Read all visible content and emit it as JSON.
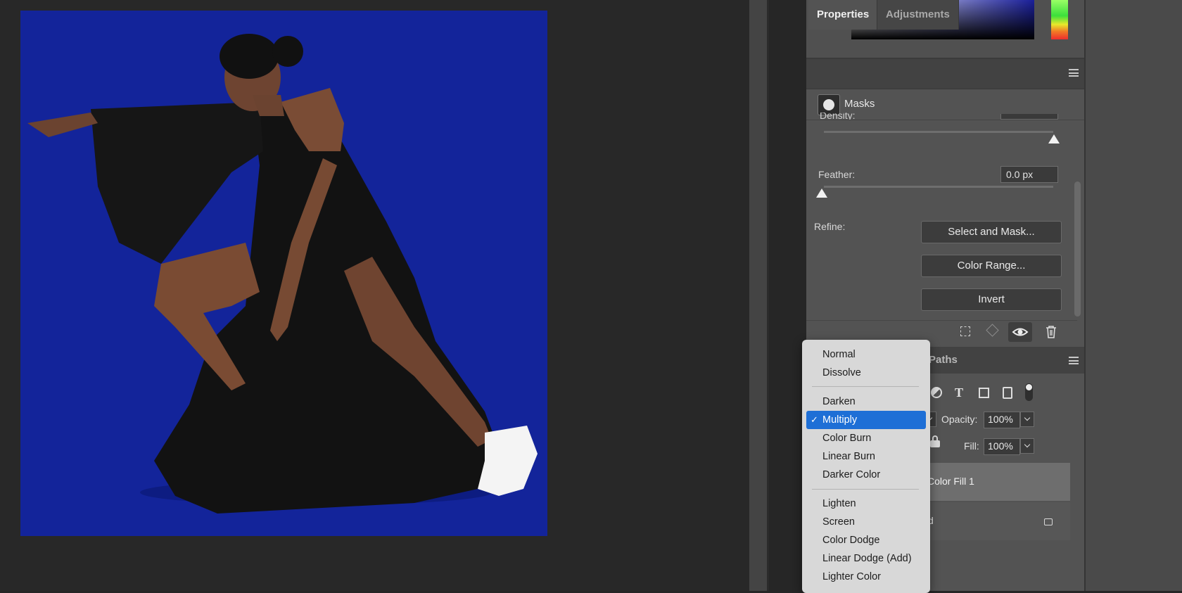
{
  "properties_panel": {
    "tabs": [
      "Properties",
      "Adjustments"
    ],
    "section": "Masks",
    "density_label": "Density:",
    "feather_label": "Feather:",
    "feather_value": "0.0 px",
    "refine_label": "Refine:",
    "buttons": [
      "Select and Mask...",
      "Color Range...",
      "Invert"
    ],
    "density_percent": 100,
    "feather_percent": 0,
    "footer_icons": [
      "selection-icon",
      "apply-mask-icon",
      "eye-icon",
      "trash-icon"
    ]
  },
  "layers_panel": {
    "tab_partial": "Paths",
    "filter_icons": [
      "adjustment-filter-icon",
      "type-filter-icon",
      "shape-filter-icon",
      "smart-object-filter-icon",
      "filter-toggle-icon"
    ],
    "opacity_label": "Opacity:",
    "opacity_value": "100%",
    "fill_label": "Fill:",
    "fill_value": "100%",
    "layers": [
      {
        "name": "Color Fill 1",
        "selected": true
      },
      {
        "name": "d",
        "selected": false,
        "locked": true
      }
    ]
  },
  "blend_mode_menu": {
    "groups": [
      [
        "Normal",
        "Dissolve"
      ],
      [
        "Darken",
        "Multiply",
        "Color Burn",
        "Linear Burn",
        "Darker Color"
      ],
      [
        "Lighten",
        "Screen",
        "Color Dodge",
        "Linear Dodge (Add)",
        "Lighter Color"
      ]
    ],
    "selected": "Multiply",
    "check_mark": "✓"
  },
  "colors": {
    "canvas_background": "#13249a",
    "selection_highlight": "#1e6fd6",
    "panel": "#535353"
  }
}
